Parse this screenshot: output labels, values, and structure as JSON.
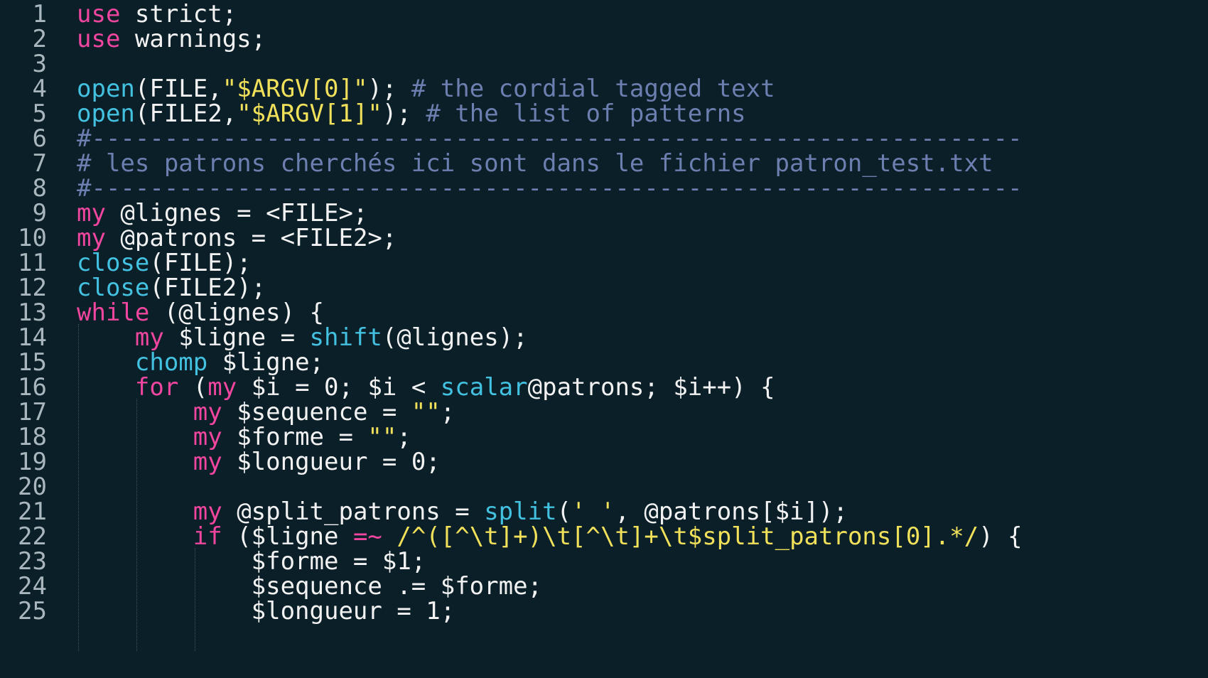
{
  "editor": {
    "language": "perl",
    "colors": {
      "background": "#0b1f28",
      "plain": "#f2f2f2",
      "keyword": "#f0469f",
      "function": "#43c1e0",
      "string": "#f0e05a",
      "comment": "#6c7fb0",
      "line_number": "#a9b6bd"
    },
    "lines": [
      {
        "num": "1",
        "tokens": [
          {
            "t": "use",
            "c": "keyword"
          },
          {
            "t": " strict;",
            "c": "plain"
          }
        ]
      },
      {
        "num": "2",
        "tokens": [
          {
            "t": "use",
            "c": "keyword"
          },
          {
            "t": " warnings;",
            "c": "plain"
          }
        ]
      },
      {
        "num": "3",
        "tokens": []
      },
      {
        "num": "4",
        "tokens": [
          {
            "t": "open",
            "c": "func"
          },
          {
            "t": "(FILE,",
            "c": "plain"
          },
          {
            "t": "\"$ARGV[0]\"",
            "c": "string"
          },
          {
            "t": "); ",
            "c": "plain"
          },
          {
            "t": "# the cordial tagged text",
            "c": "comment"
          }
        ]
      },
      {
        "num": "5",
        "tokens": [
          {
            "t": "open",
            "c": "func"
          },
          {
            "t": "(FILE2,",
            "c": "plain"
          },
          {
            "t": "\"$ARGV[1]\"",
            "c": "string"
          },
          {
            "t": "); ",
            "c": "plain"
          },
          {
            "t": "# the list of patterns",
            "c": "comment"
          }
        ]
      },
      {
        "num": "6",
        "tokens": [
          {
            "t": "#----------------------------------------------------------------",
            "c": "comment"
          }
        ]
      },
      {
        "num": "7",
        "tokens": [
          {
            "t": "# les patrons cherchés ici sont dans le fichier patron_test.txt",
            "c": "comment"
          }
        ]
      },
      {
        "num": "8",
        "tokens": [
          {
            "t": "#----------------------------------------------------------------",
            "c": "comment"
          }
        ]
      },
      {
        "num": "9",
        "tokens": [
          {
            "t": "my",
            "c": "keyword"
          },
          {
            "t": " @lignes = <FILE>;",
            "c": "plain"
          }
        ]
      },
      {
        "num": "10",
        "tokens": [
          {
            "t": "my",
            "c": "keyword"
          },
          {
            "t": " @patrons = <FILE2>;",
            "c": "plain"
          }
        ]
      },
      {
        "num": "11",
        "tokens": [
          {
            "t": "close",
            "c": "func"
          },
          {
            "t": "(FILE);",
            "c": "plain"
          }
        ]
      },
      {
        "num": "12",
        "tokens": [
          {
            "t": "close",
            "c": "func"
          },
          {
            "t": "(FILE2);",
            "c": "plain"
          }
        ]
      },
      {
        "num": "13",
        "tokens": [
          {
            "t": "while",
            "c": "keyword"
          },
          {
            "t": " (@lignes) {",
            "c": "plain"
          }
        ]
      },
      {
        "num": "14",
        "tokens": [
          {
            "t": "    ",
            "c": "plain"
          },
          {
            "t": "my",
            "c": "keyword"
          },
          {
            "t": " $ligne = ",
            "c": "plain"
          },
          {
            "t": "shift",
            "c": "func"
          },
          {
            "t": "(@lignes);",
            "c": "plain"
          }
        ]
      },
      {
        "num": "15",
        "tokens": [
          {
            "t": "    ",
            "c": "plain"
          },
          {
            "t": "chomp",
            "c": "func"
          },
          {
            "t": " $ligne;",
            "c": "plain"
          }
        ]
      },
      {
        "num": "16",
        "tokens": [
          {
            "t": "    ",
            "c": "plain"
          },
          {
            "t": "for",
            "c": "keyword"
          },
          {
            "t": " (",
            "c": "plain"
          },
          {
            "t": "my",
            "c": "keyword"
          },
          {
            "t": " $i = 0; $i < ",
            "c": "plain"
          },
          {
            "t": "scalar",
            "c": "func"
          },
          {
            "t": "@patrons; $i++) {",
            "c": "plain"
          }
        ]
      },
      {
        "num": "17",
        "tokens": [
          {
            "t": "        ",
            "c": "plain"
          },
          {
            "t": "my",
            "c": "keyword"
          },
          {
            "t": " $sequence = ",
            "c": "plain"
          },
          {
            "t": "\"\"",
            "c": "string"
          },
          {
            "t": ";",
            "c": "plain"
          }
        ]
      },
      {
        "num": "18",
        "tokens": [
          {
            "t": "        ",
            "c": "plain"
          },
          {
            "t": "my",
            "c": "keyword"
          },
          {
            "t": " $forme = ",
            "c": "plain"
          },
          {
            "t": "\"\"",
            "c": "string"
          },
          {
            "t": ";",
            "c": "plain"
          }
        ]
      },
      {
        "num": "19",
        "tokens": [
          {
            "t": "        ",
            "c": "plain"
          },
          {
            "t": "my",
            "c": "keyword"
          },
          {
            "t": " $longueur = 0;",
            "c": "plain"
          }
        ]
      },
      {
        "num": "20",
        "tokens": []
      },
      {
        "num": "21",
        "tokens": [
          {
            "t": "        ",
            "c": "plain"
          },
          {
            "t": "my",
            "c": "keyword"
          },
          {
            "t": " @split_patrons = ",
            "c": "plain"
          },
          {
            "t": "split",
            "c": "func"
          },
          {
            "t": "(",
            "c": "plain"
          },
          {
            "t": "' '",
            "c": "string"
          },
          {
            "t": ", @patrons[$i]);",
            "c": "plain"
          }
        ]
      },
      {
        "num": "22",
        "tokens": [
          {
            "t": "        ",
            "c": "plain"
          },
          {
            "t": "if",
            "c": "keyword"
          },
          {
            "t": " ($ligne ",
            "c": "plain"
          },
          {
            "t": "=~",
            "c": "keyword"
          },
          {
            "t": " ",
            "c": "plain"
          },
          {
            "t": "/^([^\\t]+)\\t[^\\t]+\\t$split_patrons[0].*/",
            "c": "string"
          },
          {
            "t": ") {",
            "c": "plain"
          }
        ]
      },
      {
        "num": "23",
        "tokens": [
          {
            "t": "            $forme = $1;",
            "c": "plain"
          }
        ]
      },
      {
        "num": "24",
        "tokens": [
          {
            "t": "            $sequence .= $forme;",
            "c": "plain"
          }
        ]
      },
      {
        "num": "25",
        "tokens": [
          {
            "t": "            $longueur = 1;",
            "c": "plain"
          }
        ]
      }
    ]
  }
}
